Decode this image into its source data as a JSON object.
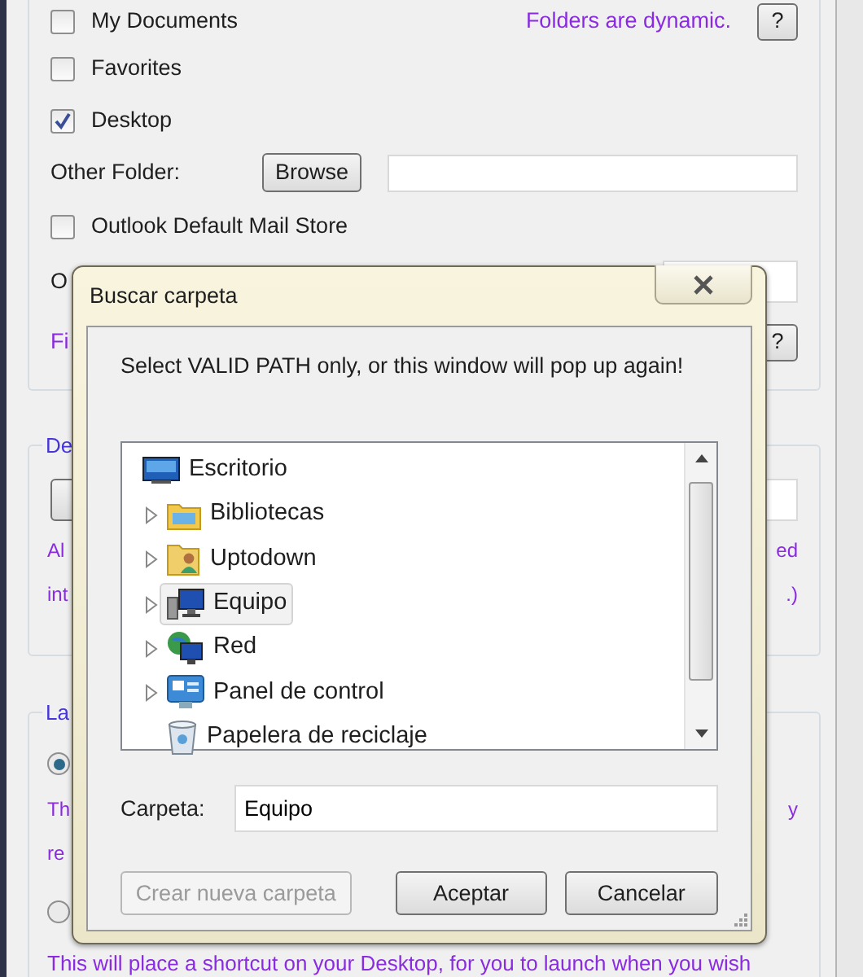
{
  "folders_group": {
    "note": "Folders are dynamic.",
    "help": "?",
    "rows": [
      {
        "kind": "checkbox",
        "label": "My Documents",
        "checked": false
      },
      {
        "kind": "checkbox",
        "label": "Favorites",
        "checked": false
      },
      {
        "kind": "checkbox",
        "label": "Desktop",
        "checked": true
      },
      {
        "kind": "browse",
        "label": "Other Folder:",
        "button": "Browse"
      },
      {
        "kind": "checkbox",
        "label": "Outlook Default Mail Store",
        "checked": false
      },
      {
        "kind": "field",
        "label": "O"
      },
      {
        "kind": "note",
        "left": "Fi",
        "help": "?"
      }
    ]
  },
  "group_2": {
    "label": "De",
    "lines": [
      {
        "left": "Al",
        "right": "ed"
      },
      {
        "left": "int",
        "right": ".)"
      }
    ]
  },
  "group_3": {
    "label": "La",
    "options": [
      {
        "selected": true,
        "lines": [
          {
            "left": "Th",
            "right": "y"
          },
          {
            "left": "re"
          }
        ]
      },
      {
        "selected": false,
        "description": "This will place a shortcut on your Desktop, for you to launch when you wish"
      }
    ]
  },
  "dialog": {
    "title": "Buscar carpeta",
    "message": "Select VALID PATH only, or this window will pop up again!",
    "tree": [
      {
        "label": "Escritorio",
        "selected": false,
        "children": [
          {
            "label": "Bibliotecas",
            "expandable": true,
            "selected": false
          },
          {
            "label": "Uptodown",
            "expandable": true,
            "selected": false
          },
          {
            "label": "Equipo",
            "expandable": true,
            "selected": true
          },
          {
            "label": "Red",
            "expandable": true,
            "selected": false
          },
          {
            "label": "Panel de control",
            "expandable": true,
            "selected": false
          },
          {
            "label": "Papelera de reciclaje",
            "expandable": false,
            "selected": false
          }
        ]
      }
    ],
    "folder_label": "Carpeta:",
    "folder_value": "Equipo",
    "buttons": [
      {
        "label": "Crear nueva carpeta",
        "disabled": true
      },
      {
        "label": "Aceptar",
        "disabled": false
      },
      {
        "label": "Cancelar",
        "disabled": false
      }
    ]
  }
}
